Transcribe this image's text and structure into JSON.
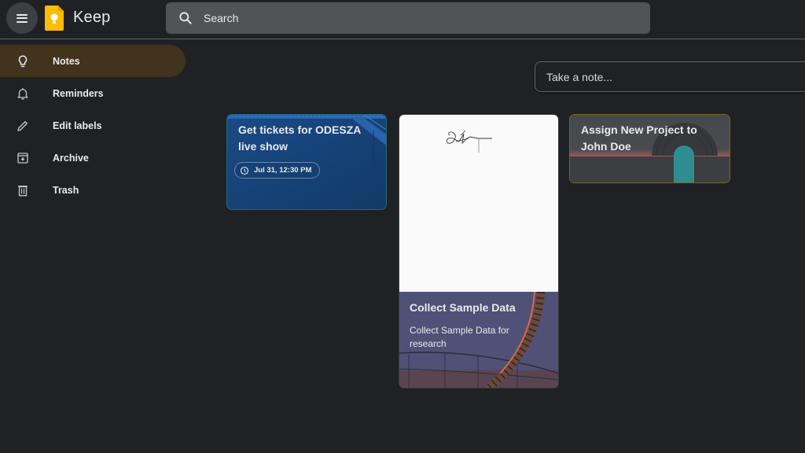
{
  "header": {
    "app_title": "Keep",
    "search_placeholder": "Search"
  },
  "sidebar": {
    "items": [
      {
        "label": "Notes",
        "icon": "lightbulb-icon",
        "active": true
      },
      {
        "label": "Reminders",
        "icon": "bell-icon",
        "active": false
      },
      {
        "label": "Edit labels",
        "icon": "pencil-icon",
        "active": false
      },
      {
        "label": "Archive",
        "icon": "archive-icon",
        "active": false
      },
      {
        "label": "Trash",
        "icon": "trash-icon",
        "active": false
      }
    ]
  },
  "main": {
    "take_note_placeholder": "Take a note...",
    "notes": [
      {
        "title": "Get tickets for ODESZA live show",
        "reminder": "Jul 31, 12:30 PM",
        "theme": "music-blue"
      },
      {
        "title": "Collect Sample Data",
        "body": "Collect Sample Data for research",
        "has_drawing": true,
        "theme": "rollercoaster"
      },
      {
        "title": "Assign New Project to John Doe",
        "theme": "vinyl"
      }
    ]
  },
  "colors": {
    "background": "#202124",
    "active_nav": "#41331c",
    "search_bg": "#525355",
    "keep_yellow": "#fbbc04"
  }
}
